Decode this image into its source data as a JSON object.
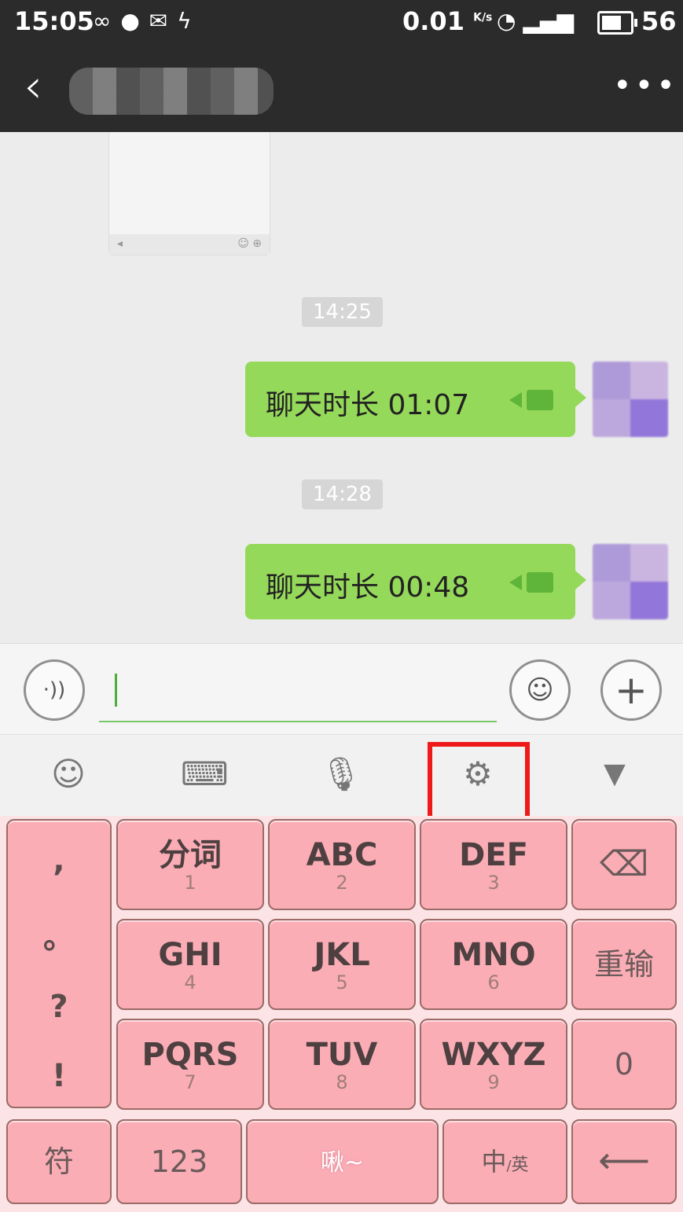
{
  "status_bar": {
    "time": "15:05",
    "net_speed": "0.01",
    "net_speed_unit": "K/s",
    "battery": "56",
    "left_icons": [
      "infinity-icon",
      "chat-icon",
      "mail-icon",
      "bolt-icon"
    ],
    "right_icons": [
      "wifi-icon",
      "signal-3g-icon",
      "battery-icon"
    ]
  },
  "header": {
    "back_glyph": "‹",
    "more_glyph": "•••"
  },
  "chat": {
    "messages": [
      {
        "timestamp": "14:25",
        "text": "聊天时长 01:07"
      },
      {
        "timestamp": "14:28",
        "text": "聊天时长 00:48"
      }
    ]
  },
  "input": {
    "value": "",
    "voice_glyph": "·))",
    "emoji_glyph": "☺",
    "plus_glyph": "+"
  },
  "ime_toolbar": {
    "items": [
      "emoji-icon",
      "keyboard-icon",
      "microphone-icon",
      "settings-icon",
      "collapse-icon"
    ]
  },
  "keyboard": {
    "punct": [
      ",",
      "。",
      "?",
      "!"
    ],
    "keys": [
      {
        "main": "分词",
        "sub": "1"
      },
      {
        "main": "ABC",
        "sub": "2"
      },
      {
        "main": "DEF",
        "sub": "3"
      },
      {
        "main": "GHI",
        "sub": "4"
      },
      {
        "main": "JKL",
        "sub": "5"
      },
      {
        "main": "MNO",
        "sub": "6"
      },
      {
        "main": "PQRS",
        "sub": "7"
      },
      {
        "main": "TUV",
        "sub": "8"
      },
      {
        "main": "WXYZ",
        "sub": "9"
      }
    ],
    "reinput": "重输",
    "zero": "0",
    "symbols": "符",
    "numbers": "123",
    "space_label": "啾~",
    "lang_main": "中",
    "lang_sep": "/",
    "lang_alt": "英"
  },
  "colors": {
    "bubble": "#95d95a",
    "key": "#fbadb6",
    "highlight": "#ee1a1a",
    "header": "#2b2b2b"
  }
}
